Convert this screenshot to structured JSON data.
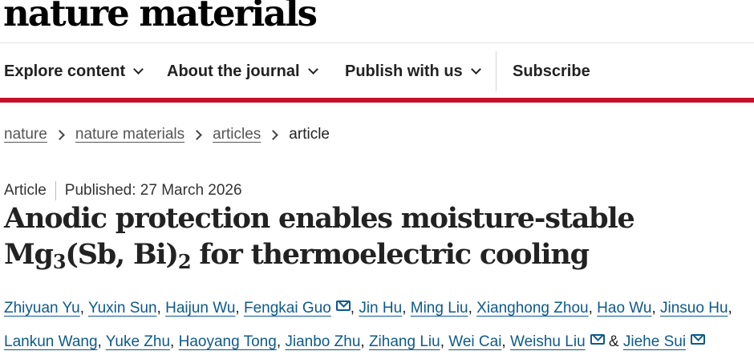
{
  "site": {
    "logo": "nature materials"
  },
  "nav": {
    "items": [
      {
        "label": "Explore content",
        "icon": "chevron-down-icon"
      },
      {
        "label": "About the journal",
        "icon": "chevron-down-icon"
      },
      {
        "label": "Publish with us",
        "icon": "chevron-down-icon"
      }
    ],
    "subscribe": "Subscribe"
  },
  "colors": {
    "accent_bar": "#c8102e",
    "link": "#0c5a8c"
  },
  "breadcrumb": [
    "nature",
    "nature materials",
    "articles",
    "article"
  ],
  "article": {
    "type": "Article",
    "published": "Published: 27 March 2026",
    "title": {
      "part1": "Anodic protection enables moisture-stable Mg",
      "sub1": "3",
      "part2": "(Sb, Bi)",
      "sub2": "2",
      "part3": " for thermoelectric cooling"
    }
  },
  "authors": {
    "list": [
      {
        "name": "Zhiyuan Yu",
        "email_icon": false
      },
      {
        "name": "Yuxin Sun",
        "email_icon": false
      },
      {
        "name": "Haijun Wu",
        "email_icon": false
      },
      {
        "name": "Fengkai Guo",
        "email_icon": true
      },
      {
        "name": "Jin Hu",
        "email_icon": false
      },
      {
        "name": "Ming Liu",
        "email_icon": false
      },
      {
        "name": "Xianghong Zhou",
        "email_icon": false
      },
      {
        "name": "Hao Wu",
        "email_icon": false
      },
      {
        "name": "Jinsuo Hu",
        "email_icon": false
      },
      {
        "name": "Lankun Wang",
        "email_icon": false
      },
      {
        "name": "Yuke Zhu",
        "email_icon": false
      },
      {
        "name": "Haoyang Tong",
        "email_icon": false
      },
      {
        "name": "Jianbo Zhu",
        "email_icon": false
      },
      {
        "name": "Zihang Liu",
        "email_icon": false
      },
      {
        "name": "Wei Cai",
        "email_icon": false
      },
      {
        "name": "Weishu Liu",
        "email_icon": true
      },
      {
        "name": "Jiehe Sui",
        "email_icon": true
      }
    ],
    "separator": ", ",
    "last_separator": " & "
  }
}
